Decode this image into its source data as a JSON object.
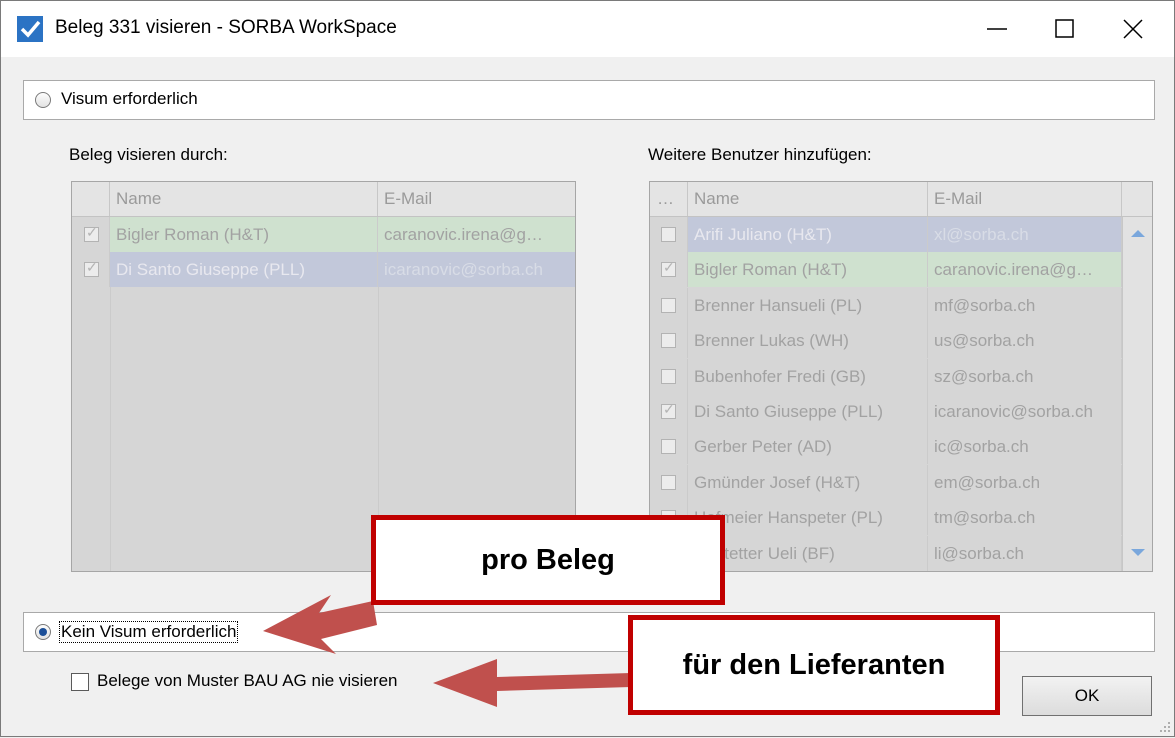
{
  "window": {
    "title": "Beleg 331 visieren - SORBA WorkSpace"
  },
  "options": {
    "visum_required": "Visum erforderlich",
    "visum_not_required": "Kein Visum erforderlich",
    "never_visa": "Belege von Muster BAU AG nie visieren"
  },
  "left_list": {
    "title": "Beleg visieren durch:",
    "columns": [
      "Name",
      "E-Mail"
    ],
    "rows": [
      {
        "name": "Bigler Roman (H&T)",
        "email": "caranovic.irena@g…",
        "checked": true
      },
      {
        "name": "Di Santo Giuseppe (PLL)",
        "email": "icaranovic@sorba.ch",
        "checked": true
      }
    ]
  },
  "right_list": {
    "title": "Weitere Benutzer hinzufügen:",
    "columns": [
      "…",
      "Name",
      "E-Mail"
    ],
    "rows": [
      {
        "name": "Arifi Juliano (H&T)",
        "email": "xl@sorba.ch",
        "checked": false
      },
      {
        "name": "Bigler Roman (H&T)",
        "email": "caranovic.irena@g…",
        "checked": true
      },
      {
        "name": "Brenner Hansueli (PL)",
        "email": "mf@sorba.ch",
        "checked": false
      },
      {
        "name": "Brenner Lukas (WH)",
        "email": "us@sorba.ch",
        "checked": false
      },
      {
        "name": "Bubenhofer Fredi (GB)",
        "email": "sz@sorba.ch",
        "checked": false
      },
      {
        "name": "Di Santo Giuseppe (PLL)",
        "email": "icaranovic@sorba.ch",
        "checked": true
      },
      {
        "name": "Gerber Peter (AD)",
        "email": "ic@sorba.ch",
        "checked": false
      },
      {
        "name": "Gmünder Josef (H&T)",
        "email": "em@sorba.ch",
        "checked": false
      },
      {
        "name": "Hofmeier Hanspeter (PL)",
        "email": "tm@sorba.ch",
        "checked": false
      },
      {
        "name": "Hostetter Ueli (BF)",
        "email": "li@sorba.ch",
        "checked": false
      }
    ]
  },
  "buttons": {
    "ok": "OK"
  },
  "callouts": {
    "per_document": "pro Beleg",
    "for_supplier": "für den Lieferanten"
  },
  "colors": {
    "callout_border": "#c00000",
    "arrow": "#c0504d",
    "selected_green": "#cfe1cf",
    "selected_blue": "#c2c8da"
  }
}
